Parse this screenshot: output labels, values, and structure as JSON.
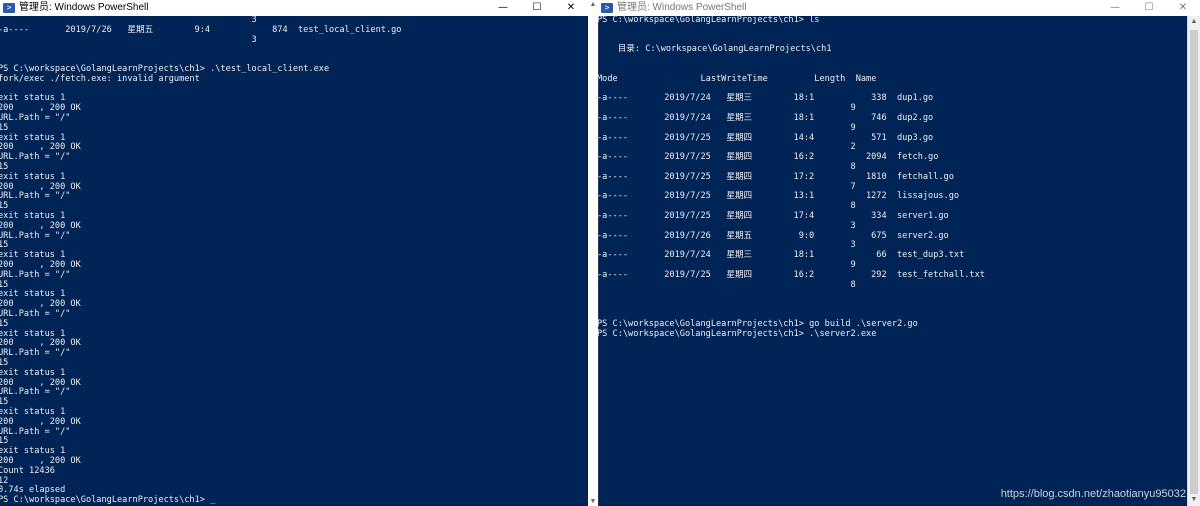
{
  "left_window": {
    "title": "管理员: Windows PowerShell",
    "icon": "powershell-icon",
    "buttons": {
      "minimize": "—",
      "maximize": "☐",
      "close": "✕"
    },
    "lines": [
      "                                                 3",
      "-a----       2019/7/26   星期五        9:4            874  test_local_client.go",
      "                                                 3",
      "",
      "",
      "PS C:\\workspace\\GolangLearnProjects\\ch1> .\\test_local_client.exe",
      "fork/exec ./fetch.exe: invalid argument",
      "",
      "exit status 1",
      "200     , 200 OK",
      "URL.Path = \"/\"",
      "15",
      "exit status 1",
      "200     , 200 OK",
      "URL.Path = \"/\"",
      "15",
      "exit status 1",
      "200     , 200 OK",
      "URL.Path = \"/\"",
      "15",
      "exit status 1",
      "200     , 200 OK",
      "URL.Path = \"/\"",
      "15",
      "exit status 1",
      "200     , 200 OK",
      "URL.Path = \"/\"",
      "15",
      "exit status 1",
      "200     , 200 OK",
      "URL.Path = \"/\"",
      "15",
      "exit status 1",
      "200     , 200 OK",
      "URL.Path = \"/\"",
      "15",
      "exit status 1",
      "200     , 200 OK",
      "URL.Path = \"/\"",
      "15",
      "exit status 1",
      "200     , 200 OK",
      "URL.Path = \"/\"",
      "15",
      "exit status 1",
      "200     , 200 OK",
      "Count 12436",
      "12",
      "0.74s elapsed",
      "PS C:\\workspace\\GolangLearnProjects\\ch1> _"
    ]
  },
  "right_window": {
    "title": "管理员: Windows PowerShell",
    "icon": "powershell-icon",
    "buttons": {
      "minimize": "—",
      "maximize": "☐",
      "close": "✕"
    },
    "lines": [
      "PS C:\\workspace\\GolangLearnProjects\\ch1> ls",
      "",
      "",
      "    目录: C:\\workspace\\GolangLearnProjects\\ch1",
      "",
      "",
      "Mode                LastWriteTime         Length  Name",
      "",
      "-a----       2019/7/24   星期三        18:1           338  dup1.go",
      "                                                 9",
      "-a----       2019/7/24   星期三        18:1           746  dup2.go",
      "                                                 9",
      "-a----       2019/7/25   星期四        14:4           571  dup3.go",
      "                                                 2",
      "-a----       2019/7/25   星期四        16:2          2094  fetch.go",
      "                                                 8",
      "-a----       2019/7/25   星期四        17:2          1810  fetchall.go",
      "                                                 7",
      "-a----       2019/7/25   星期四        13:1          1272  lissajous.go",
      "                                                 8",
      "-a----       2019/7/25   星期四        17:4           334  server1.go",
      "                                                 3",
      "-a----       2019/7/26   星期五         9:0           675  server2.go",
      "                                                 3",
      "-a----       2019/7/24   星期三        18:1            66  test_dup3.txt",
      "                                                 9",
      "-a----       2019/7/25   星期四        16:2           292  test_fetchall.txt",
      "                                                 8",
      "",
      "",
      "",
      "PS C:\\workspace\\GolangLearnProjects\\ch1> go build .\\server2.go",
      "PS C:\\workspace\\GolangLearnProjects\\ch1> .\\server2.exe"
    ]
  },
  "watermark": "https://blog.csdn.net/zhaotianyu95032",
  "colors": {
    "console_bg": "#012456",
    "console_fg": "#eeedf0"
  }
}
